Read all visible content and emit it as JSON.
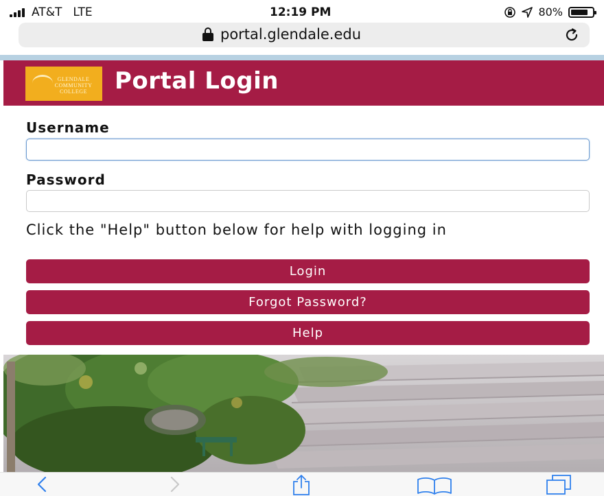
{
  "status_bar": {
    "carrier": "AT&T",
    "network": "LTE",
    "time": "12:19 PM",
    "battery": "80%",
    "battery_level": 0.8,
    "icons": [
      "signal-icon",
      "rotation-lock-icon",
      "location-icon",
      "battery-icon"
    ]
  },
  "browser": {
    "url": "portal.glendale.edu",
    "icons": [
      "lock-icon",
      "reload-icon"
    ]
  },
  "header": {
    "title": "Portal Login",
    "logo_text_top": "GLENDALE",
    "logo_text_mid": "COMMUNITY",
    "logo_text_bottom": "COLLEGE",
    "background": "#a51c45",
    "logo_color": "#f2ae1e"
  },
  "form": {
    "username_label": "Username",
    "username_value": "",
    "password_label": "Password",
    "password_value": "",
    "help_text": "Click the \"Help\" button below for help with logging in"
  },
  "buttons": {
    "login": "Login",
    "forgot": "Forgot Password?",
    "help": "Help",
    "color": "#a51c45"
  },
  "toolbar": {
    "icons": [
      "back-icon",
      "forward-icon",
      "share-icon",
      "bookmarks-icon",
      "tabs-icon"
    ]
  }
}
